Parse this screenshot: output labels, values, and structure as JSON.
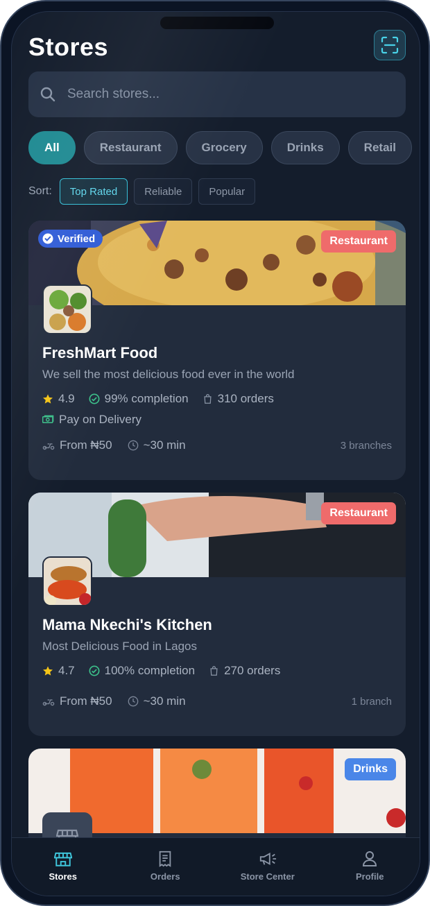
{
  "header": {
    "title": "Stores"
  },
  "search": {
    "placeholder": "Search stores..."
  },
  "categories": [
    "All",
    "Restaurant",
    "Grocery",
    "Drinks",
    "Retail"
  ],
  "sort": {
    "label": "Sort:",
    "options": [
      "Top Rated",
      "Reliable",
      "Popular"
    ],
    "selected": "Top Rated"
  },
  "stores": [
    {
      "name": "FreshMart Food",
      "description": "We sell the most delicious food ever in the world",
      "verified_label": "Verified",
      "category": "Restaurant",
      "rating": "4.9",
      "completion": "99% completion",
      "orders": "310 orders",
      "payment": "Pay on Delivery",
      "delivery_fee": "From ₦50",
      "eta": "~30 min",
      "branches": "3 branches"
    },
    {
      "name": "Mama Nkechi's Kitchen",
      "description": "Most Delicious Food in Lagos",
      "category": "Restaurant",
      "rating": "4.7",
      "completion": "100% completion",
      "orders": "270 orders",
      "delivery_fee": "From ₦50",
      "eta": "~30 min",
      "branches": "1 branch"
    },
    {
      "category": "Drinks"
    }
  ],
  "tabbar": [
    "Stores",
    "Orders",
    "Store Center",
    "Profile"
  ],
  "colors": {
    "accent": "#1f8a92",
    "restaurant_badge": "#ef6b6b",
    "drinks_badge": "#4a86e8",
    "verified_badge": "#2f5bd6",
    "star": "#f5c518",
    "check": "#3cc08a"
  }
}
